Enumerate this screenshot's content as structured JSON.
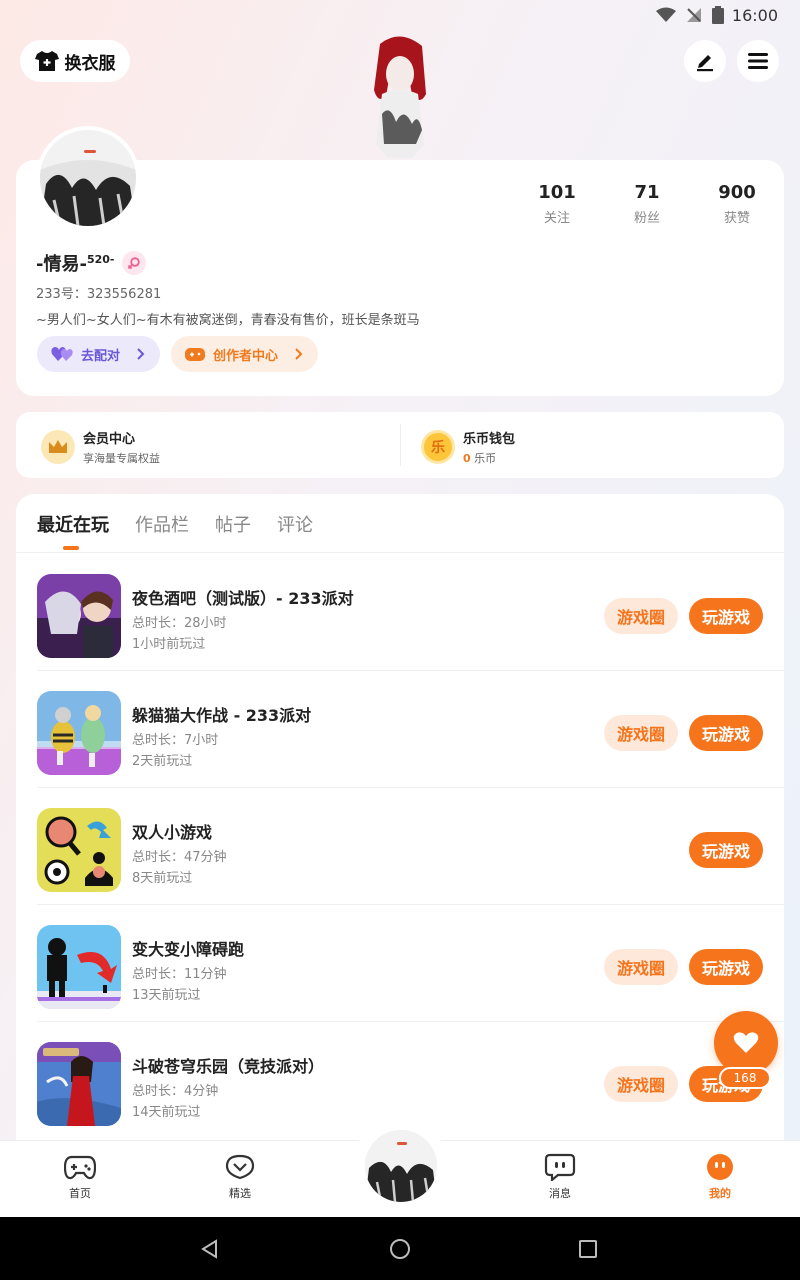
{
  "status_bar": {
    "time": "16:00"
  },
  "header": {
    "outfit_label": "换衣服"
  },
  "profile": {
    "nickname": "-情易-",
    "nickname_sup": "520-",
    "uid": "233号：323556281",
    "bio": "~男人们~女人们~有木有被窝迷倒，青春没有售价，班长是条斑马",
    "stats": [
      {
        "value": "101",
        "label": "关注"
      },
      {
        "value": "71",
        "label": "粉丝"
      },
      {
        "value": "900",
        "label": "获赞"
      }
    ],
    "match_label": "去配对",
    "creator_label": "创作者中心"
  },
  "member": {
    "vip_title": "会员中心",
    "vip_sub": "享海量专属权益",
    "wallet_title": "乐币钱包",
    "wallet_icon_char": "乐",
    "wallet_amount": "0",
    "wallet_unit": "乐币"
  },
  "tabs": [
    "最近在玩",
    "作品栏",
    "帖子",
    "评论"
  ],
  "games": [
    {
      "name": "夜色酒吧（测试版）- 233派对",
      "duration": "总时长：28小时",
      "last": "1小时前玩过",
      "circle": "游戏圈",
      "play": "玩游戏"
    },
    {
      "name": "躲猫猫大作战 - 233派对",
      "duration": "总时长：7小时",
      "last": "2天前玩过",
      "circle": "游戏圈",
      "play": "玩游戏"
    },
    {
      "name": "双人小游戏",
      "duration": "总时长：47分钟",
      "last": "8天前玩过",
      "circle": "",
      "play": "玩游戏"
    },
    {
      "name": "变大变小障碍跑",
      "duration": "总时长：11分钟",
      "last": "13天前玩过",
      "circle": "游戏圈",
      "play": "玩游戏"
    },
    {
      "name": "斗破苍穹乐园（竞技派对）",
      "duration": "总时长：4分钟",
      "last": "14天前玩过",
      "circle": "游戏圈",
      "play": "玩游戏"
    }
  ],
  "fab": {
    "count": "168"
  },
  "bottom_nav": [
    {
      "label": "首页",
      "icon": "gamepad-icon"
    },
    {
      "label": "精选",
      "icon": "heart-chat-icon"
    },
    {
      "label": "消息",
      "icon": "message-icon"
    },
    {
      "label": "我的",
      "icon": "profile-face-icon"
    }
  ],
  "colors": {
    "accent": "#f5741c",
    "match": "#6a57d8"
  }
}
